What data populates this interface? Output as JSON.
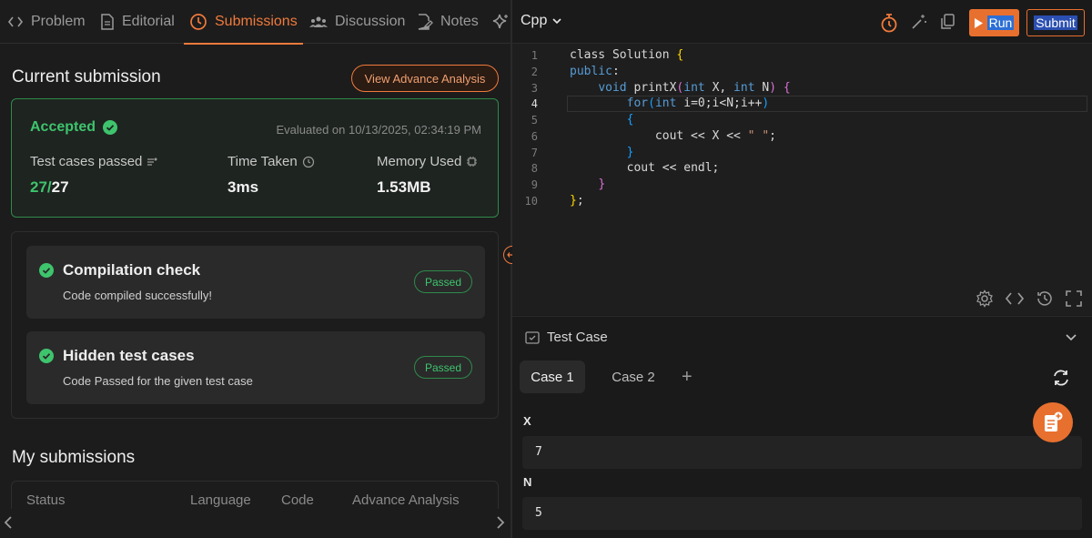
{
  "tabs": [
    {
      "label": "Problem"
    },
    {
      "label": "Editorial"
    },
    {
      "label": "Submissions"
    },
    {
      "label": "Discussion"
    },
    {
      "label": "Notes"
    }
  ],
  "submission": {
    "title": "Current submission",
    "view_analysis": "View Advance Analysis",
    "status": "Accepted",
    "evaluated": "Evaluated on 10/13/2025, 02:34:19 PM",
    "test_cases_label": "Test cases passed",
    "passed": "27/",
    "total": "27",
    "time_label": "Time Taken",
    "time_value": "3ms",
    "memory_label": "Memory Used",
    "memory_value": "1.53MB"
  },
  "checks": [
    {
      "title": "Compilation check",
      "subtitle": "Code compiled successfully!",
      "badge": "Passed"
    },
    {
      "title": "Hidden test cases",
      "subtitle": "Code Passed for the given test case",
      "badge": "Passed"
    }
  ],
  "my_submissions": {
    "title": "My submissions",
    "columns": [
      "Status",
      "Language",
      "Code",
      "Advance Analysis"
    ]
  },
  "editor": {
    "language": "Cpp",
    "run_label": "Run",
    "submit_label": "Submit",
    "line_numbers": [
      "1",
      "2",
      "3",
      "4",
      "5",
      "6",
      "7",
      "8",
      "9",
      "10"
    ]
  },
  "testcase": {
    "title": "Test Case",
    "cases": [
      "Case 1",
      "Case 2"
    ],
    "add": "+",
    "vars": [
      {
        "name": "X",
        "value": "7"
      },
      {
        "name": "N",
        "value": "5"
      }
    ]
  },
  "colors": {
    "accent": "#f07a3c",
    "success": "#3ec46d",
    "background": "#1a1a1a"
  },
  "icons": [
    "code-brackets-icon",
    "document-icon",
    "clock-icon",
    "people-icon",
    "note-edit-icon",
    "sparkle-icon",
    "timer-icon",
    "magic-wand-icon",
    "copy-icon",
    "play-icon",
    "check-circle-icon",
    "gear-icon",
    "history-icon",
    "fullscreen-icon",
    "refresh-icon",
    "notes-fab-icon"
  ]
}
